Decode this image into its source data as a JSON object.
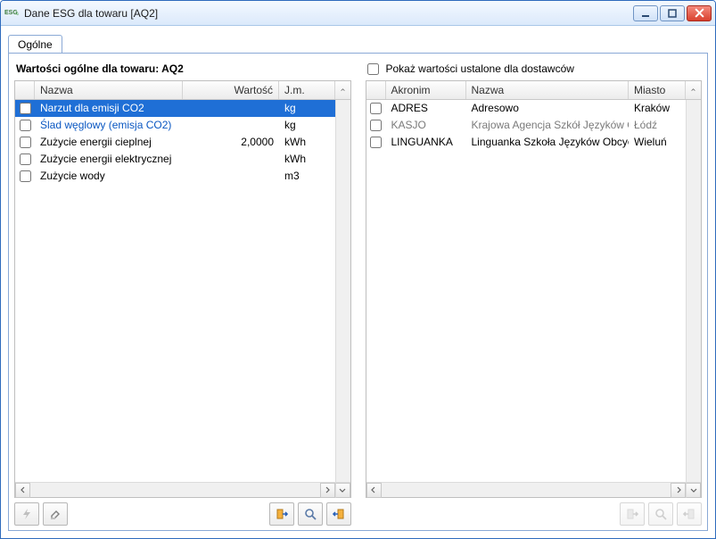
{
  "window": {
    "title": "Dane ESG dla towaru [AQ2]",
    "app_badge": "ESG"
  },
  "tabs": {
    "general": "Ogólne"
  },
  "left_pane": {
    "title": "Wartości ogólne dla towaru: AQ2",
    "columns": {
      "name": "Nazwa",
      "value": "Wartość",
      "uom": "J.m."
    },
    "rows": [
      {
        "checked": false,
        "name": "Narzut dla emisji CO2",
        "value": "",
        "uom": "kg",
        "selected": true
      },
      {
        "checked": false,
        "name": "Ślad węglowy (emisja CO2)",
        "value": "",
        "uom": "kg",
        "link": true
      },
      {
        "checked": false,
        "name": "Zużycie energii cieplnej",
        "value": "2,0000",
        "uom": "kWh"
      },
      {
        "checked": false,
        "name": "Zużycie energii elektrycznej",
        "value": "",
        "uom": "kWh"
      },
      {
        "checked": false,
        "name": "Zużycie wody",
        "value": "",
        "uom": "m3"
      }
    ]
  },
  "right_pane": {
    "show_supplier_label": "Pokaż wartości ustalone dla dostawców",
    "show_supplier_checked": false,
    "columns": {
      "acronym": "Akronim",
      "name": "Nazwa",
      "city": "Miasto"
    },
    "rows": [
      {
        "checked": false,
        "acronym": "ADRES",
        "name": "Adresowo",
        "city": "Kraków"
      },
      {
        "checked": false,
        "acronym": "KASJO",
        "name": "Krajowa Agencja Szkół Języków Obcy",
        "city": "Łódź",
        "gray": true
      },
      {
        "checked": false,
        "acronym": "LINGUANKA",
        "name": "Linguanka Szkoła Języków Obcych",
        "city": "Wieluń"
      }
    ]
  }
}
